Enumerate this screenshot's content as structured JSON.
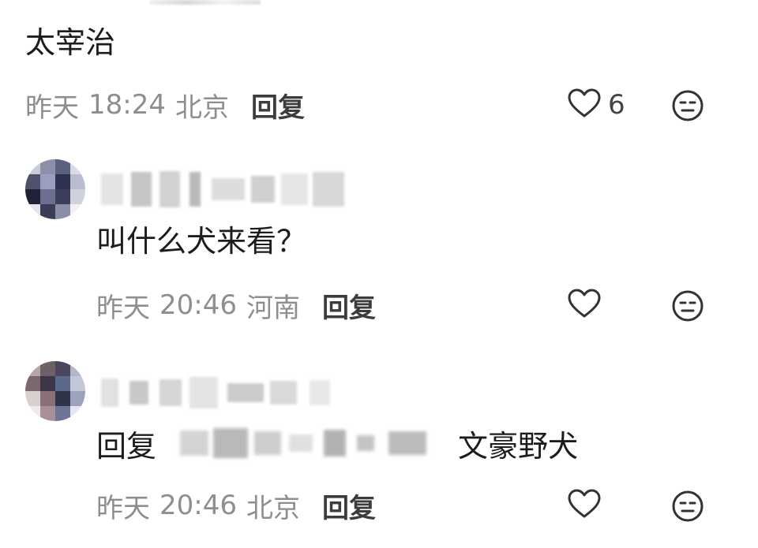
{
  "comments": [
    {
      "text": "太宰治",
      "date": "昨天",
      "time": "18:24",
      "location": "北京",
      "reply_label": "回复",
      "likes": "6"
    },
    {
      "text": "叫什么犬来看？",
      "date": "昨天",
      "time": "20:46",
      "location": "河南",
      "reply_label": "回复",
      "likes": ""
    },
    {
      "reply_prefix": "回复",
      "text": "文豪野犬",
      "date": "昨天",
      "time": "20:46",
      "location": "北京",
      "reply_label": "回复",
      "likes": ""
    }
  ],
  "icons": {
    "like": "heart-outline-icon",
    "dislike": "neutral-face-icon"
  },
  "colors": {
    "meta_text": "#8e8e8e",
    "body_text": "#1c1c1c",
    "reply_link": "#3c3c3c",
    "icon_stroke": "#333333"
  }
}
